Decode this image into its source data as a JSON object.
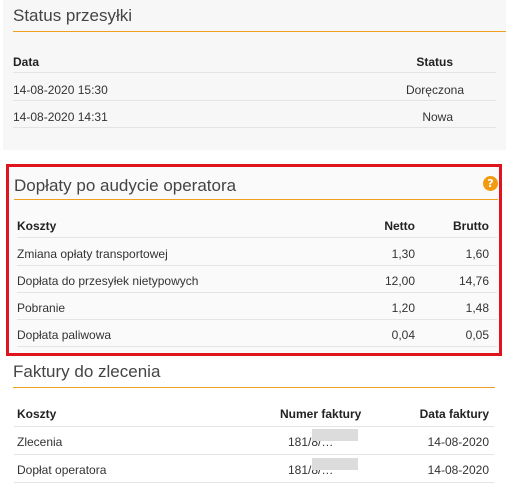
{
  "status_section": {
    "title": "Status przesyłki",
    "columns": {
      "date": "Data",
      "status": "Status"
    },
    "rows": [
      {
        "date": "14-08-2020 15:30",
        "status": "Doręczona"
      },
      {
        "date": "14-08-2020 14:31",
        "status": "Nowa"
      }
    ]
  },
  "doplaty_section": {
    "title": "Dopłaty po audycie operatora",
    "help_icon": "question-circle-icon",
    "help_glyph": "?",
    "highlight_color": "#e0141c",
    "columns": {
      "costs": "Koszty",
      "net": "Netto",
      "gross": "Brutto"
    },
    "rows": [
      {
        "name": "Zmiana opłaty transportowej",
        "net": "1,30",
        "gross": "1,60"
      },
      {
        "name": "Dopłata do przesyłek nietypowych",
        "net": "12,00",
        "gross": "14,76"
      },
      {
        "name": "Pobranie",
        "net": "1,20",
        "gross": "1,48"
      },
      {
        "name": "Dopłata paliwowa",
        "net": "0,04",
        "gross": "0,05"
      }
    ]
  },
  "faktury_section": {
    "title": "Faktury do zlecenia",
    "columns": {
      "costs": "Koszty",
      "invoice_number": "Numer faktury",
      "invoice_date": "Data faktury"
    },
    "rows": [
      {
        "name": "Zlecenia",
        "invoice_number": "181/8/…",
        "invoice_date": "14-08-2020"
      },
      {
        "name": "Dopłat operatora",
        "invoice_number": "181/8/…",
        "invoice_date": "14-08-2020"
      }
    ]
  },
  "colors": {
    "accent_underline": "#f0a020",
    "help_icon": "#f29b12"
  }
}
